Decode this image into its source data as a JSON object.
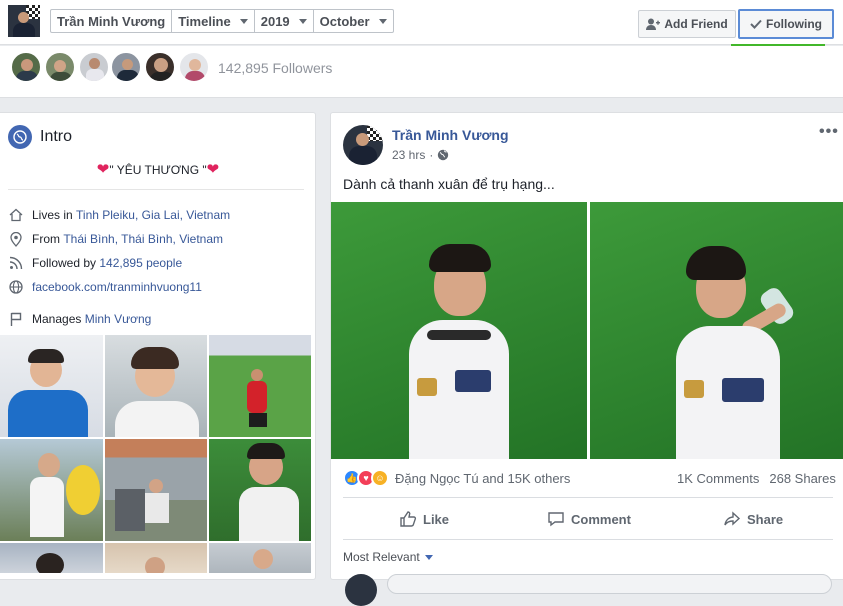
{
  "header": {
    "breadcrumbs": [
      "Trần Minh Vương",
      "Timeline",
      "2019",
      "October"
    ],
    "add_friend_label": "Add Friend",
    "following_label": "Following"
  },
  "followers": {
    "count_text": "142,895 Followers"
  },
  "intro": {
    "title": "Intro",
    "bio": "\" YÊU THƯƠNG \"",
    "lives_prefix": "Lives in ",
    "lives_place": "Tinh Pleiku, Gia Lai, Vietnam",
    "from_prefix": "From ",
    "from_place": "Thái Bình, Thái Bình, Vietnam",
    "followed_prefix": "Followed by ",
    "followed_count": "142,895 people",
    "website": "facebook.com/tranminhvuong11",
    "manages_prefix": "Manages ",
    "manages_page": "Minh Vương"
  },
  "post": {
    "author": "Trần Minh Vương",
    "time": "23 hrs",
    "separator": "·",
    "text": "Dành cả thanh xuân để trụ hạng...",
    "reactions_text": "Đặng Ngọc Tú and 15K others",
    "comments_count": "1K Comments",
    "shares_count": "268 Shares",
    "like_label": "Like",
    "comment_label": "Comment",
    "share_label": "Share",
    "sort_label": "Most Relevant"
  },
  "colors": {
    "link": "#385898",
    "accent": "#4267b2",
    "green": "#42b72a"
  }
}
